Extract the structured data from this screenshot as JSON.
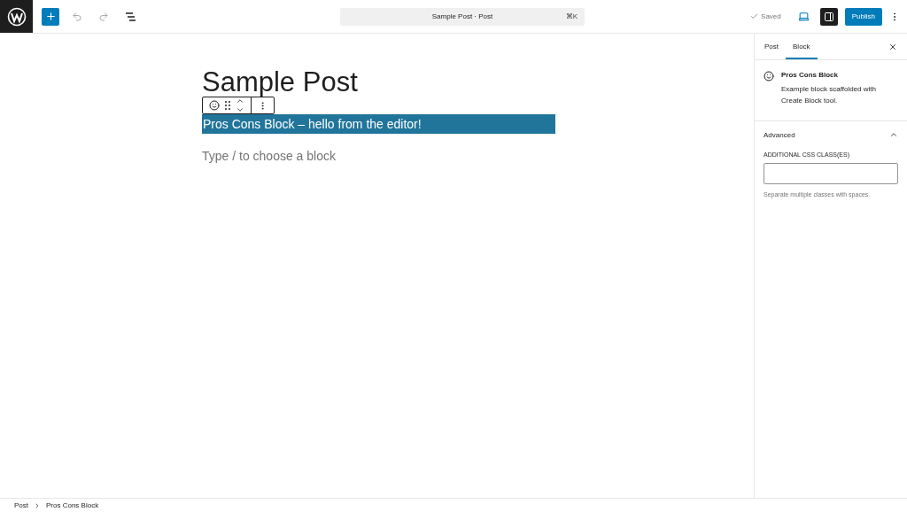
{
  "top_bar": {
    "document_title": "Sample Post · Post",
    "shortcut": "⌘K",
    "save_status": "Saved",
    "publish_button": "Publish",
    "settings_open": true
  },
  "editor": {
    "title": "Sample Post",
    "blocks": [
      {
        "kind": "custom",
        "text": "Pros Cons Block – hello from the editor!",
        "selected": true
      },
      {
        "kind": "placeholder",
        "text": "Type / to choose a block"
      }
    ]
  },
  "sidebar": {
    "tabs": [
      {
        "label": "Post",
        "selected": false
      },
      {
        "label": "Block",
        "selected": true
      }
    ],
    "block_card": {
      "name": "Pros Cons Block",
      "description": "Example block scaffolded with Create Block tool."
    },
    "panels": [
      {
        "title": "Advanced",
        "expanded": true,
        "field_label": "ADDITIONAL CSS CLASS(ES)",
        "help": "Separate multiple classes with spaces."
      }
    ]
  },
  "breadcrumbs": [
    "Post",
    "Pros Cons Block"
  ]
}
